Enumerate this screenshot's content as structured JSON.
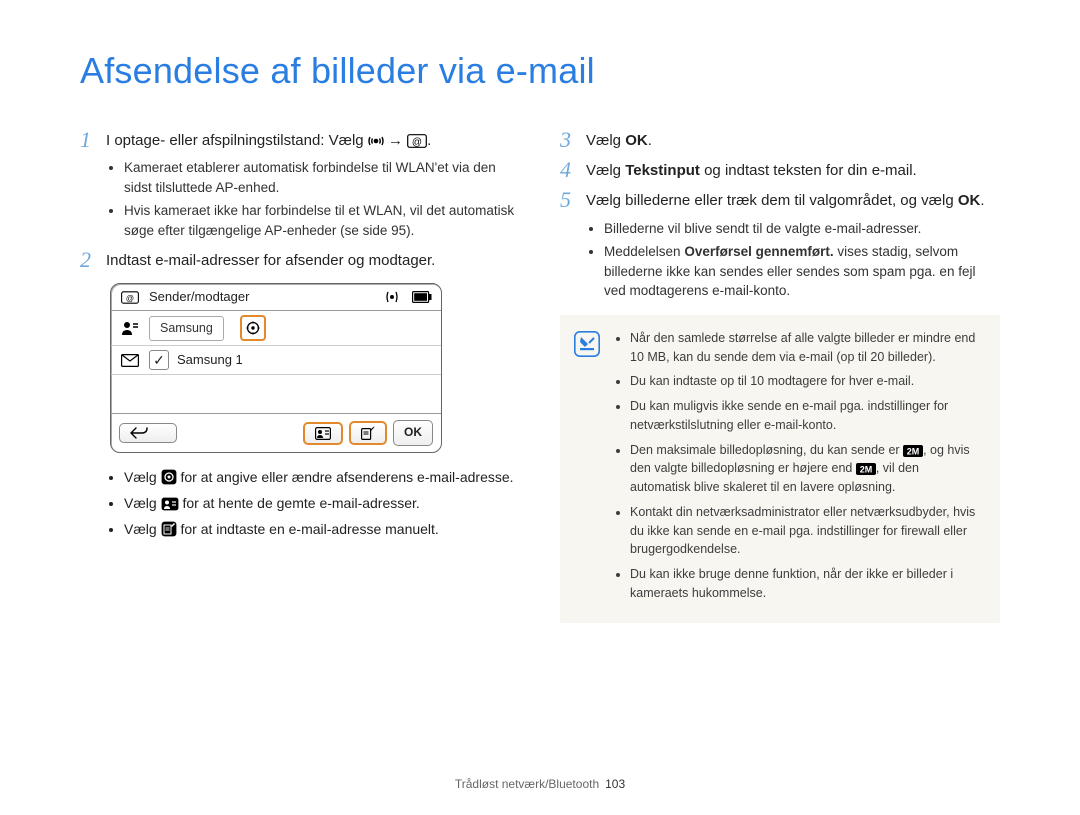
{
  "title": "Afsendelse af billeder via e-mail",
  "left": {
    "step1": "I optage- eller afspilningstilstand: Vælg ",
    "step1_tail": ".",
    "step1_arrow": "→",
    "step1_bullets": [
      "Kameraet etablerer automatisk forbindelse til WLAN'et via den sidst tilsluttede AP-enhed.",
      "Hvis kameraet ikke har forbindelse til et WLAN, vil det automatisk søge efter tilgængelige AP-enheder (se side 95)."
    ],
    "step2": "Indtast e-mail-adresser for afsender og modtager.",
    "camera": {
      "header_label": "Sender/modtager",
      "sender_value": "Samsung",
      "receiver_value": "Samsung 1",
      "back": "↶",
      "ok": "OK"
    },
    "below_cam": [
      {
        "pre": "Vælg ",
        "post": " for at angive eller ændre afsenderens e-mail-adresse.",
        "icon": "gear"
      },
      {
        "pre": "Vælg ",
        "post": " for at hente de gemte e-mail-adresser.",
        "icon": "card"
      },
      {
        "pre": "Vælg ",
        "post": " for at indtaste en e-mail-adresse manuelt.",
        "icon": "compose"
      }
    ]
  },
  "right": {
    "step3_pre": "Vælg ",
    "step3_b": "OK",
    "step3_post": ".",
    "step4_pre": "Vælg ",
    "step4_b": "Tekstinput",
    "step4_post": " og indtast teksten for din e-mail.",
    "step5_line": "Vælg billederne eller træk dem til valgområdet, og vælg ",
    "step5_b": "OK",
    "step5_post": ".",
    "step5_bullets": [
      "Billederne vil blive sendt til de valgte e-mail-adresser.",
      "Meddelelsen Overførsel gennemført. vises stadig, selvom billederne ikke kan sendes eller sendes som spam pga. en fejl ved modtagerens e-mail-konto."
    ],
    "step5_bullets_bold_fragment": "Overførsel gennemført.",
    "note": [
      "Når den samlede størrelse af alle valgte billeder er mindre end 10 MB, kan du sende dem via e-mail (op til 20 billeder).",
      "Du kan indtaste op til 10 modtagere for hver e-mail.",
      "Du kan muligvis ikke sende en e-mail pga. indstillinger for netværkstilslutning eller e-mail-konto.",
      "Den maksimale billedopløsning, du kan sende er 2M, og hvis den valgte billedopløsning er højere end 2M, vil den automatisk blive skaleret til en lavere opløsning.",
      "Kontakt din netværksadministrator eller netværksudbyder, hvis du ikke kan sende en e-mail pga. indstillinger for firewall eller brugergodkendelse.",
      "Du kan ikke bruge denne funktion, når der ikke er billeder i kameraets hukommelse."
    ]
  },
  "footer": {
    "section": "Trådløst netværk/Bluetooth",
    "page": "103"
  }
}
